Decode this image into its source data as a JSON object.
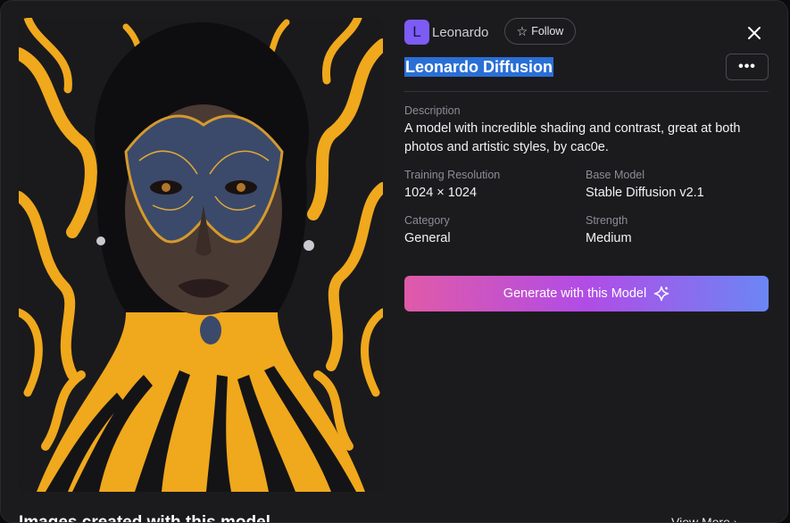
{
  "model": {
    "owner_initial": "L",
    "owner_name": "Leonardo",
    "follow_label": "Follow",
    "title": "Leonardo Diffusion",
    "more_label": "•••",
    "description_label": "Description",
    "description": "A model with incredible shading and contrast, great at both photos and artistic styles, by cac0e.",
    "details": [
      {
        "label": "Training Resolution",
        "value": "1024 × 1024"
      },
      {
        "label": "Base Model",
        "value": "Stable Diffusion v2.1"
      },
      {
        "label": "Category",
        "value": "General"
      },
      {
        "label": "Strength",
        "value": "Medium"
      }
    ],
    "generate_label": "Generate with this Model"
  },
  "footer": {
    "section_title": "Images created with this model",
    "view_more": "View More"
  },
  "icons": {
    "close": "close-icon",
    "star": "star-icon",
    "sparkle": "sparkle-icon",
    "chevron": "chevron-right-icon"
  },
  "colors": {
    "modal_bg": "#1b1b1d",
    "avatar": "#7c5cf5",
    "title_highlight": "#2a6fd6",
    "gradient_start": "#e05aa8",
    "gradient_mid": "#b14ce6",
    "gradient_end": "#6b86f5",
    "artwork_gold": "#f0a81c"
  }
}
